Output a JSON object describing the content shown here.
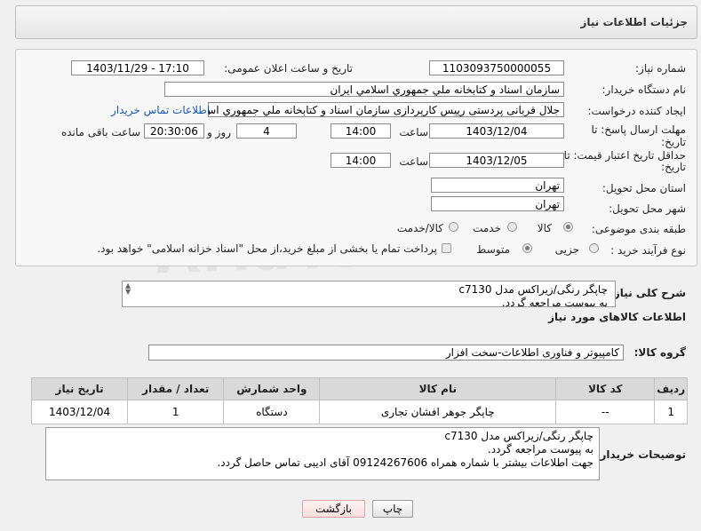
{
  "header": {
    "title": "جزئیات اطلاعات نیاز"
  },
  "form": {
    "need_number_label": "شماره نیاز:",
    "need_number": "1103093750000055",
    "announce_label": "تاریخ و ساعت اعلان عمومی:",
    "announce_value": "1403/11/29 - 17:10",
    "buyer_org_label": "نام دستگاه خریدار:",
    "buyer_org": "سازمان اسناد و کتابخانه ملي جمهوري اسلامي ايران",
    "creator_label": "ایجاد کننده درخواست:",
    "creator": "جلال قربانی پردستی رییس کارپردازی سازمان اسناد و کتابخانه ملي جمهوري اس",
    "contact_link": "اطلاعات تماس خریدار",
    "deadline_label": "مهلت ارسال پاسخ: تا",
    "deadline_label2": "تاریخ:",
    "deadline_date": "1403/12/04",
    "time_label": "ساعت",
    "deadline_time": "14:00",
    "days": "4",
    "days_label": "روز و",
    "remaining": "20:30:06",
    "remaining_label": "ساعت باقی مانده",
    "validity_label": "حداقل تاریخ اعتبار قیمت: تا",
    "validity_label2": "تاریخ:",
    "validity_date": "1403/12/05",
    "validity_time": "14:00",
    "province_label": "استان محل تحویل:",
    "province": "تهران",
    "city_label": "شهر محل تحویل:",
    "city": "تهران",
    "category_label": "طبقه بندی موضوعی:",
    "category_options": [
      "کالا",
      "خدمت",
      "کالا/خدمت"
    ],
    "process_label": "نوع فرآیند خرید :",
    "process_options": [
      "جزیی",
      "متوسط"
    ],
    "payment_note": "پرداخت تمام یا بخشی از مبلغ خرید،از محل \"اسناد خزانه اسلامی\" خواهد بود."
  },
  "description": {
    "label": "شرح کلی نیاز:",
    "line1": "چاپگر رنگی/زیراکس مدل c7130",
    "line2": "به پیوست مراجعه گردد."
  },
  "goods_info_title": "اطلاعات کالاهای مورد نیاز",
  "group": {
    "label": "گروه کالا:",
    "value": "کامپیوتر و فناوری اطلاعات-سخت افزار"
  },
  "table": {
    "headers": [
      "ردیف",
      "کد کالا",
      "نام کالا",
      "واحد شمارش",
      "تعداد / مقدار",
      "تاریخ نیاز"
    ],
    "rows": [
      [
        "1",
        "--",
        "چاپگر جوهر افشان تجاری",
        "دستگاه",
        "1",
        "1403/12/04"
      ]
    ]
  },
  "buyer_notes": {
    "label": "توضیحات خریدار:",
    "line1": "چاپگر رنگی/زیراکس مدل c7130",
    "line2": "به پیوست مراجعه گردد.",
    "line3": "جهت اطلاعات بیشتر با شماره همراه 09124267606 آقای ادیبی تماس حاصل گردد."
  },
  "buttons": {
    "print": "چاپ",
    "back": "بازگشت"
  },
  "watermark": "AriaTender.net"
}
